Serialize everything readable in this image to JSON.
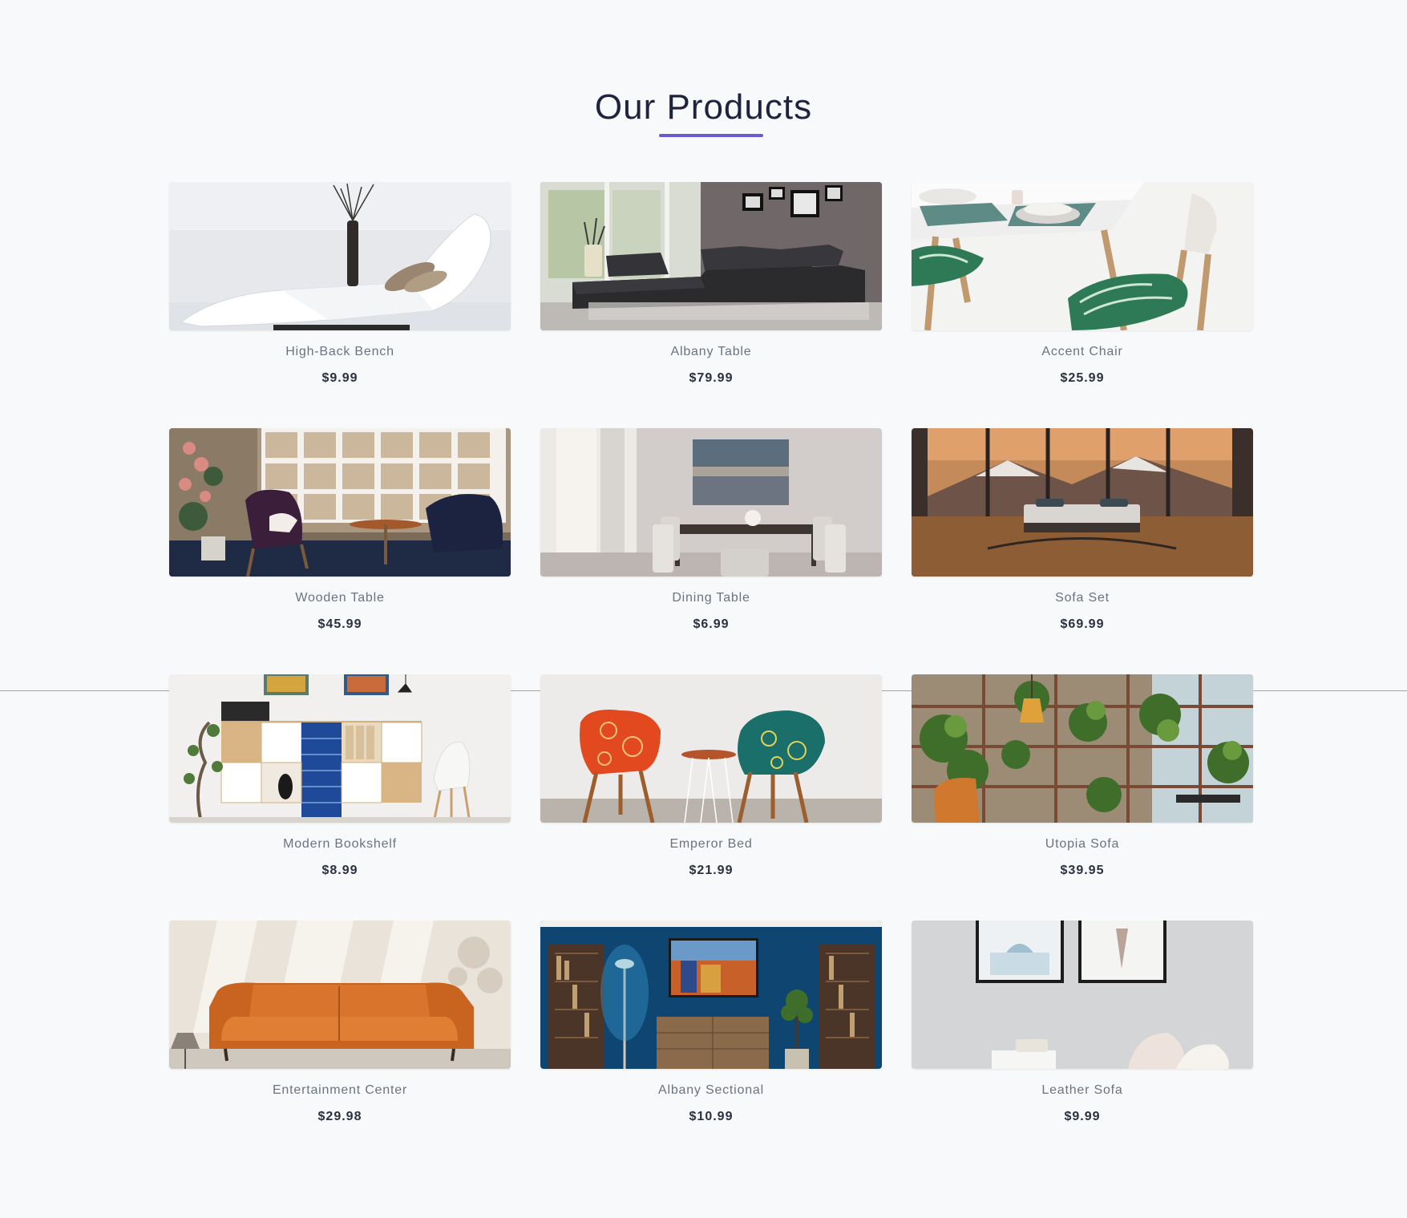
{
  "section": {
    "title": "Our Products",
    "accent_color": "#6a5acd"
  },
  "products": [
    {
      "name": "High-Back Bench",
      "price": "$9.99",
      "image": "white-chaise-lounge"
    },
    {
      "name": "Albany Table",
      "price": "$79.99",
      "image": "black-sectional-sofa"
    },
    {
      "name": "Accent Chair",
      "price": "$25.99",
      "image": "dining-table-chair"
    },
    {
      "name": "Wooden Table",
      "price": "$45.99",
      "image": "shelving-lounge-chairs"
    },
    {
      "name": "Dining Table",
      "price": "$6.99",
      "image": "dining-room"
    },
    {
      "name": "Sofa Set",
      "price": "$69.99",
      "image": "bed-mountain-view"
    },
    {
      "name": "Modern Bookshelf",
      "price": "$8.99",
      "image": "cabinet-white-chair"
    },
    {
      "name": "Emperor Bed",
      "price": "$21.99",
      "image": "patterned-chairs"
    },
    {
      "name": "Utopia Sofa",
      "price": "$39.95",
      "image": "plants-shelving"
    },
    {
      "name": "Entertainment Center",
      "price": "$29.98",
      "image": "orange-leather-sofa"
    },
    {
      "name": "Albany Sectional",
      "price": "$10.99",
      "image": "blue-wall-living-room"
    },
    {
      "name": "Leather Sofa",
      "price": "$9.99",
      "image": "framed-prints-wall"
    }
  ]
}
